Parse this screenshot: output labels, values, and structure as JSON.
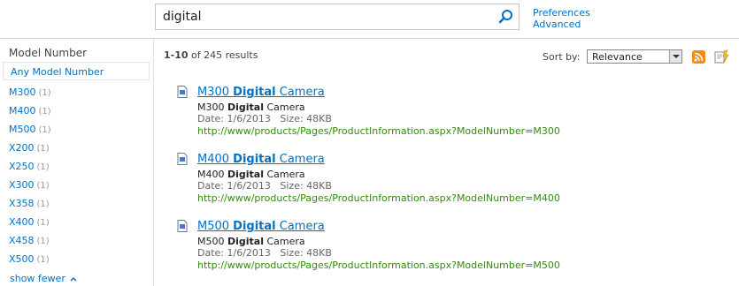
{
  "search": {
    "query": "digital"
  },
  "top_links": {
    "preferences": "Preferences",
    "advanced": "Advanced"
  },
  "refiner": {
    "title": "Model Number",
    "any_label": "Any Model Number",
    "items": [
      {
        "label": "M300",
        "count": "(1)"
      },
      {
        "label": "M400",
        "count": "(1)"
      },
      {
        "label": "M500",
        "count": "(1)"
      },
      {
        "label": "X200",
        "count": "(1)"
      },
      {
        "label": "X250",
        "count": "(1)"
      },
      {
        "label": "X300",
        "count": "(1)"
      },
      {
        "label": "X358",
        "count": "(1)"
      },
      {
        "label": "X400",
        "count": "(1)"
      },
      {
        "label": "X458",
        "count": "(1)"
      },
      {
        "label": "X500",
        "count": "(1)"
      }
    ],
    "show_fewer": "show fewer"
  },
  "results_header": {
    "range": "1-10",
    "of_text": "of 245 results",
    "sort_label": "Sort by:",
    "sort_value": "Relevance"
  },
  "results": [
    {
      "title_prefix": "M300 ",
      "title_highlight": "Digital",
      "title_suffix": " Camera",
      "summary_prefix": "M300 ",
      "summary_highlight": "Digital",
      "summary_suffix": " Camera",
      "meta": "Date: 1/6/2013   Size: 48KB",
      "url": "http://www/products/Pages/ProductInformation.aspx?ModelNumber=M300"
    },
    {
      "title_prefix": "M400 ",
      "title_highlight": "Digital",
      "title_suffix": " Camera",
      "summary_prefix": "M400 ",
      "summary_highlight": "Digital",
      "summary_suffix": " Camera",
      "meta": "Date: 1/6/2013   Size: 48KB",
      "url": "http://www/products/Pages/ProductInformation.aspx?ModelNumber=M400"
    },
    {
      "title_prefix": "M500 ",
      "title_highlight": "Digital",
      "title_suffix": " Camera",
      "summary_prefix": "M500 ",
      "summary_highlight": "Digital",
      "summary_suffix": " Camera",
      "meta": "Date: 1/6/2013   Size: 48KB",
      "url": "http://www/products/Pages/ProductInformation.aspx?ModelNumber=M500"
    }
  ],
  "colors": {
    "link": "#0072c6",
    "url": "#338a11",
    "rss": "#f08a1c"
  }
}
